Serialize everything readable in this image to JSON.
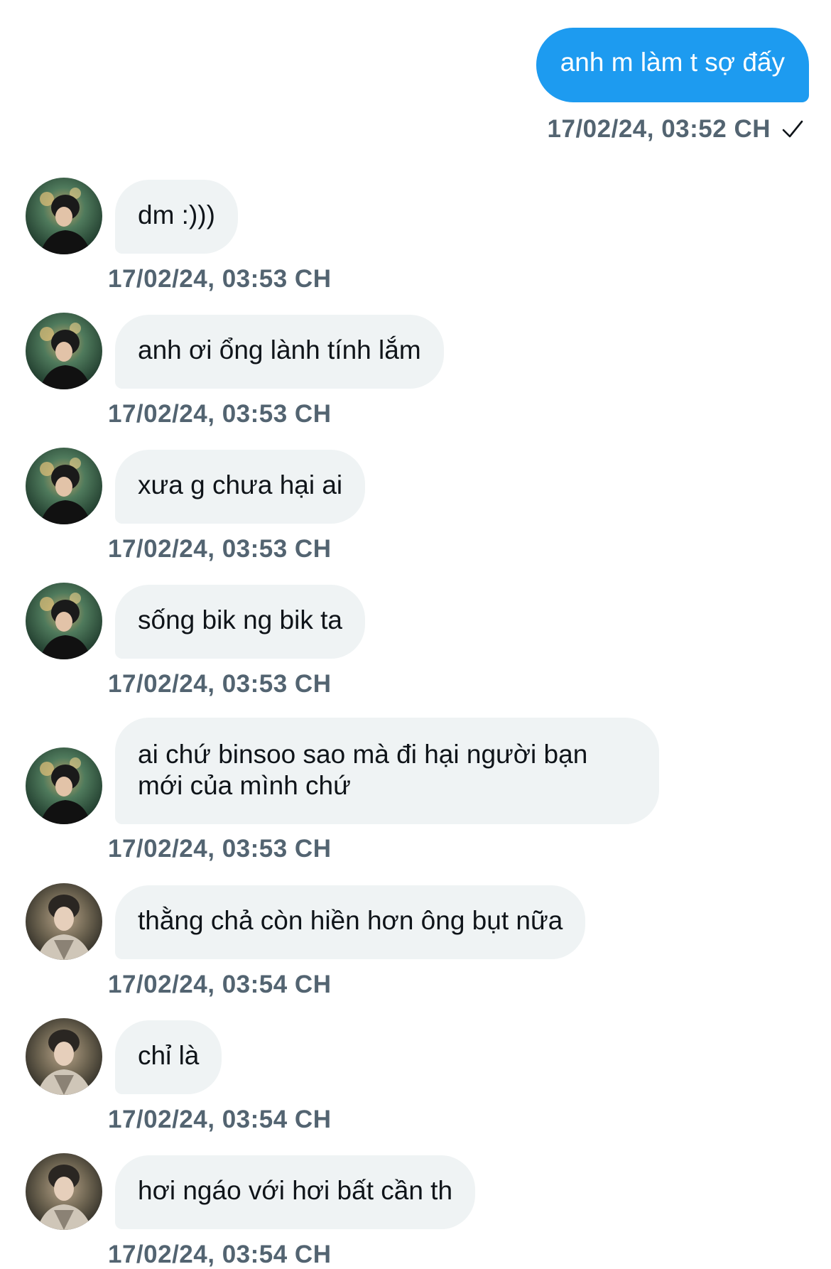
{
  "sent_message": {
    "text": "anh m làm t sợ đấy",
    "timestamp": "17/02/24, 03:52 CH",
    "status_icon": "check-icon"
  },
  "received_messages": [
    {
      "text": "dm :)))",
      "timestamp": "17/02/24, 03:53 CH",
      "avatar": "avatar-a"
    },
    {
      "text": "anh ơi ổng lành tính lắm",
      "timestamp": "17/02/24, 03:53 CH",
      "avatar": "avatar-a"
    },
    {
      "text": "xưa g chưa hại ai",
      "timestamp": "17/02/24, 03:53 CH",
      "avatar": "avatar-a"
    },
    {
      "text": "sống bik ng bik ta",
      "timestamp": "17/02/24, 03:53 CH",
      "avatar": "avatar-a"
    },
    {
      "text": "ai chứ binsoo sao mà đi hại người bạn mới của mình chứ",
      "timestamp": "17/02/24, 03:53 CH",
      "avatar": "avatar-a"
    },
    {
      "text": "thằng chả còn hiền hơn ông bụt nữa",
      "timestamp": "17/02/24, 03:54 CH",
      "avatar": "avatar-b"
    },
    {
      "text": "chỉ là",
      "timestamp": "17/02/24, 03:54 CH",
      "avatar": "avatar-b"
    },
    {
      "text": "hơi ngáo với hơi bất cần th",
      "timestamp": "17/02/24, 03:54 CH",
      "avatar": "avatar-b"
    }
  ],
  "colors": {
    "sent_bubble": "#1d9bf0",
    "received_bubble": "#eff3f4",
    "timestamp": "#536471",
    "text": "#0f1419"
  }
}
